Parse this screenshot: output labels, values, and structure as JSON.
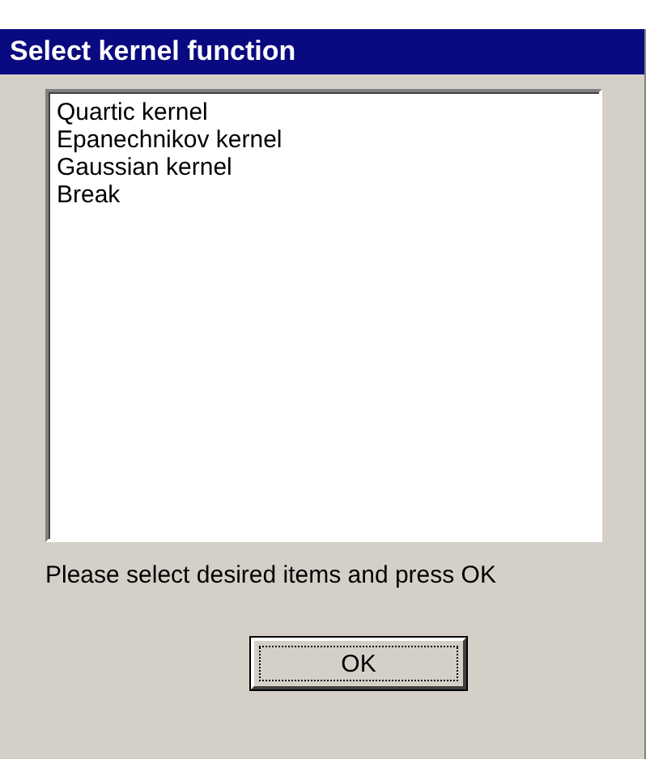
{
  "window": {
    "title": "Select kernel function"
  },
  "list": {
    "items": [
      {
        "label": "Quartic kernel",
        "selected": false
      },
      {
        "label": "Epanechnikov kernel",
        "selected": false
      },
      {
        "label": "Gaussian kernel",
        "selected": false
      },
      {
        "label": "Break",
        "selected": false
      }
    ]
  },
  "prompt": "Please select desired items and press OK",
  "buttons": [
    {
      "label": "OK",
      "focused": true
    }
  ]
}
